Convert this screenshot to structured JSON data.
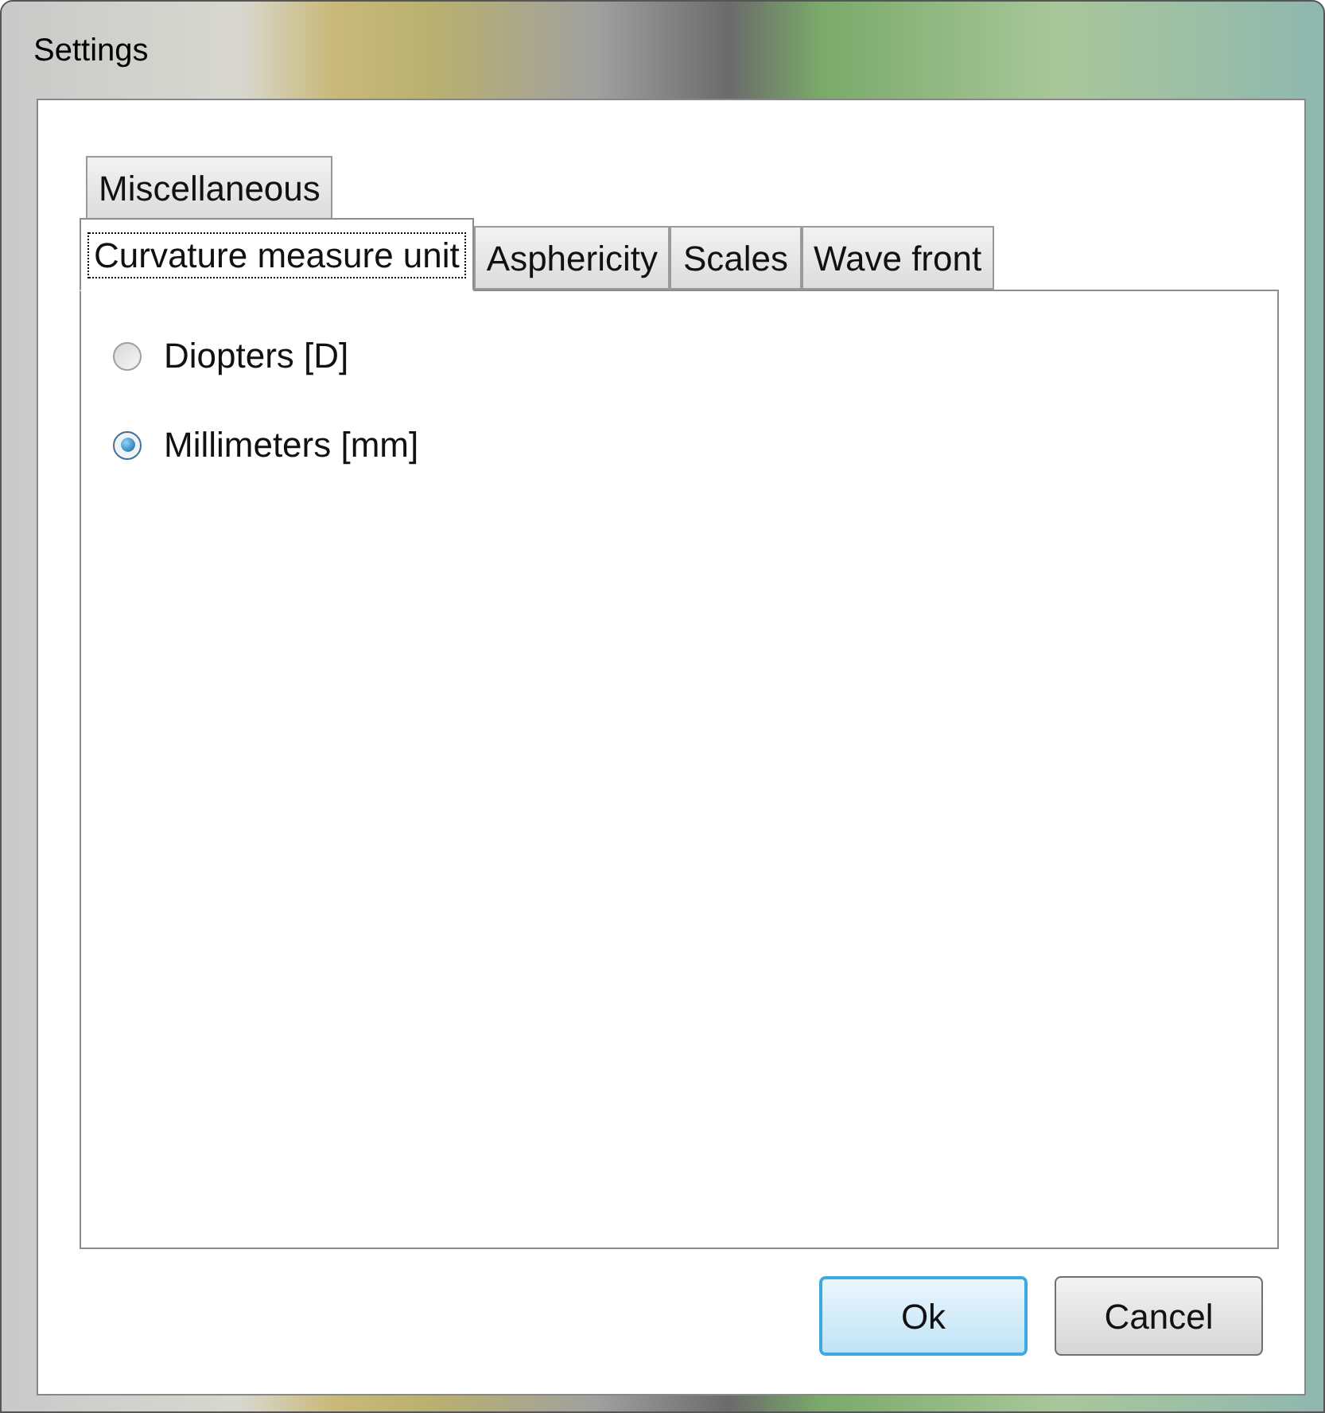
{
  "window": {
    "title": "Settings"
  },
  "tab_rows": [
    [
      {
        "label": "Miscellaneous",
        "selected": false
      }
    ],
    [
      {
        "label": "Curvature measure unit",
        "selected": true
      },
      {
        "label": "Asphericity",
        "selected": false
      },
      {
        "label": "Scales",
        "selected": false
      },
      {
        "label": "Wave front",
        "selected": false
      }
    ]
  ],
  "options": [
    {
      "label": "Diopters [D]",
      "selected": false
    },
    {
      "label": "Millimeters [mm]",
      "selected": true
    }
  ],
  "buttons": [
    {
      "label": "Ok",
      "default": true
    },
    {
      "label": "Cancel",
      "default": false
    }
  ]
}
